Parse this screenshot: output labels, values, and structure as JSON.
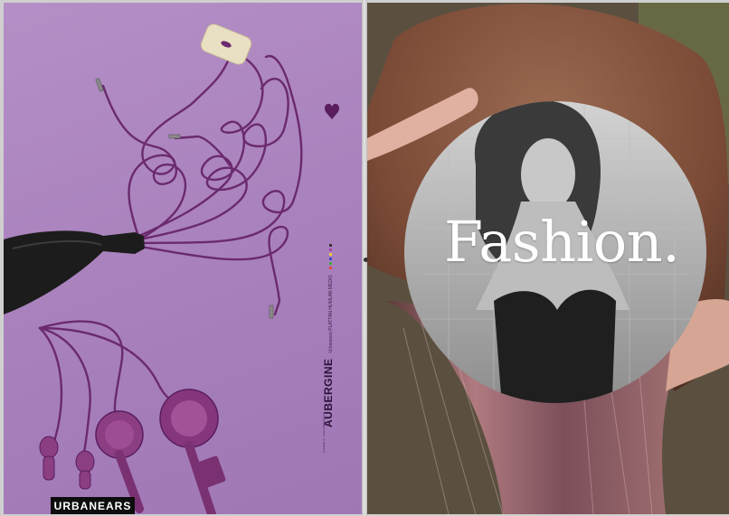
{
  "left_page": {
    "brand": "URBANEARS",
    "product_name": "AUBERGINE",
    "small_copy": "Urbanears  PLATTAN  HUMLAN  MEDIS",
    "fine_print": "Available at  ·  www.urbanears.com",
    "colors": {
      "background": "#ab83bf",
      "cable": "#6b2a6e",
      "headphone": "#8c3e82",
      "bottle": "#1c1c1c",
      "cork": "#e9e0c4"
    },
    "icons": [
      "heart-icon",
      "wine-bottle",
      "cork",
      "audio-plug",
      "earbud",
      "headphone-cup"
    ]
  },
  "right_page": {
    "title": "Fashion.",
    "colors": {
      "fur": "#7a4a36",
      "dress": "#9a6a72",
      "circle_bw": "#9a9a9a"
    }
  }
}
